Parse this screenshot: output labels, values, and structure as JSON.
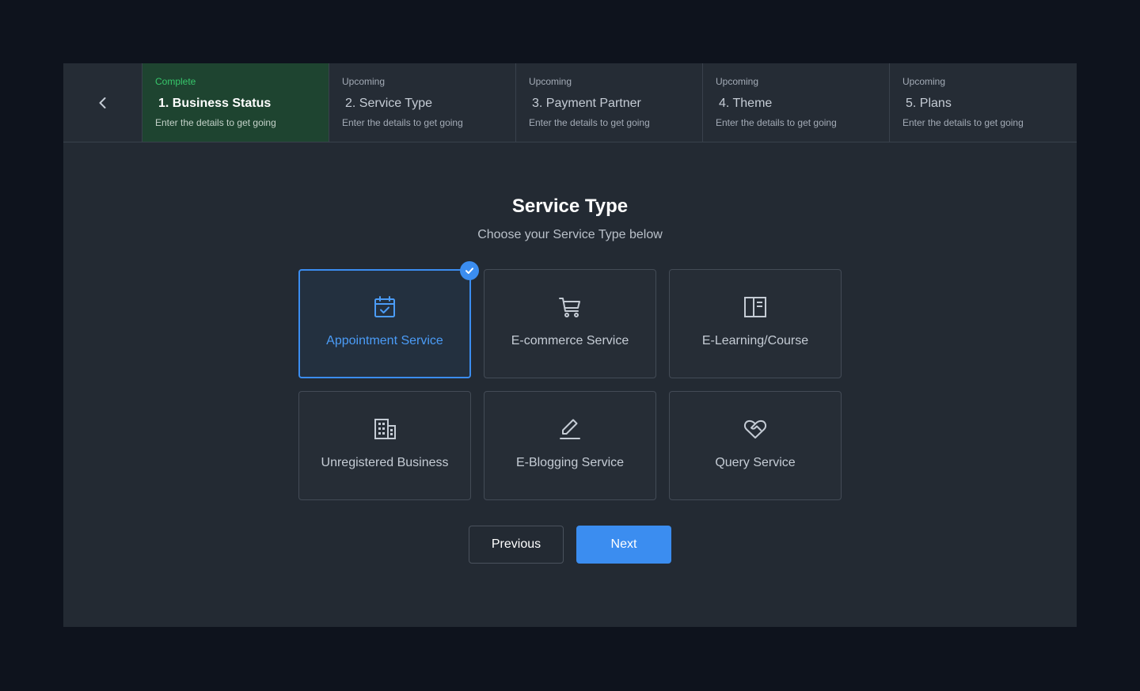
{
  "stepper": {
    "back_icon": "chevron-left-icon",
    "steps": [
      {
        "status": "Complete",
        "title": "1. Business Status",
        "subtitle": "Enter the details to get going",
        "state": "complete"
      },
      {
        "status": "Upcoming",
        "title": "2. Service Type",
        "subtitle": "Enter the details to get going",
        "state": "upcoming"
      },
      {
        "status": "Upcoming",
        "title": "3. Payment Partner",
        "subtitle": "Enter the details to get going",
        "state": "upcoming"
      },
      {
        "status": "Upcoming",
        "title": "4. Theme",
        "subtitle": "Enter the details to get going",
        "state": "upcoming"
      },
      {
        "status": "Upcoming",
        "title": "5. Plans",
        "subtitle": "Enter the details to get going",
        "state": "upcoming"
      }
    ]
  },
  "main": {
    "title": "Service Type",
    "subtitle": "Choose your Service Type below",
    "services": [
      {
        "label": "Appointment Service",
        "icon": "calendar-check-icon",
        "selected": true
      },
      {
        "label": "E-commerce Service",
        "icon": "shopping-cart-icon",
        "selected": false
      },
      {
        "label": "E-Learning/Course",
        "icon": "book-layout-icon",
        "selected": false
      },
      {
        "label": "Unregistered Business",
        "icon": "building-icon",
        "selected": false
      },
      {
        "label": "E-Blogging Service",
        "icon": "pencil-edit-icon",
        "selected": false
      },
      {
        "label": "Query Service",
        "icon": "heart-handshake-icon",
        "selected": false
      }
    ]
  },
  "actions": {
    "previous_label": "Previous",
    "next_label": "Next"
  },
  "colors": {
    "accent": "#3b8df0",
    "complete": "#37c76b",
    "complete_bg": "#1e4430",
    "panel": "#232a33",
    "background": "#0e131d"
  }
}
